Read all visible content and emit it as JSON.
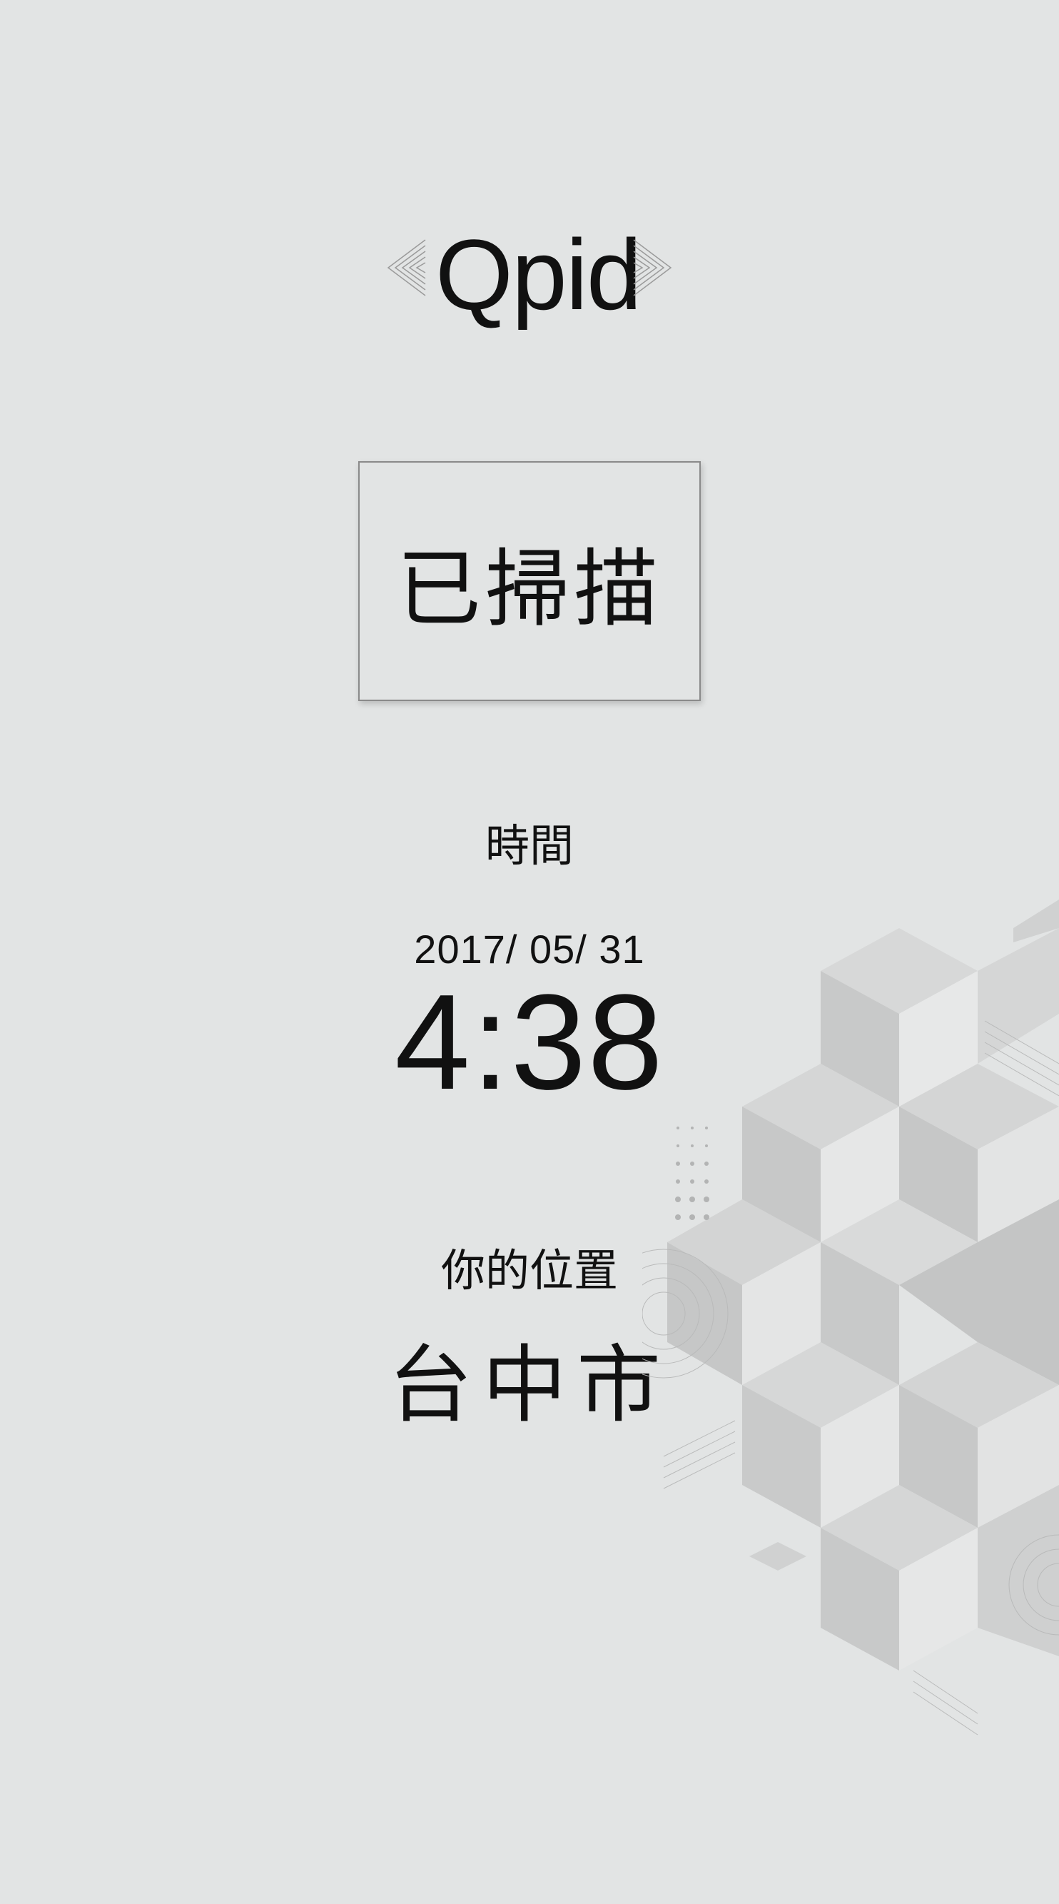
{
  "brand": {
    "name": "Qpid",
    "icon": "chevron-ornament-icon"
  },
  "scan": {
    "status": "已掃描"
  },
  "time": {
    "label": "時間",
    "date": "2017/ 05/ 31",
    "clock": "4:38"
  },
  "location": {
    "label": "你的位置",
    "value": "台中市"
  },
  "colors": {
    "background": "#e2e4e4",
    "text": "#111111",
    "box_border": "#8a8a8a",
    "cube_light": "#e6e7e7",
    "cube_mid": "#d3d4d4",
    "cube_dark": "#c5c6c6"
  }
}
